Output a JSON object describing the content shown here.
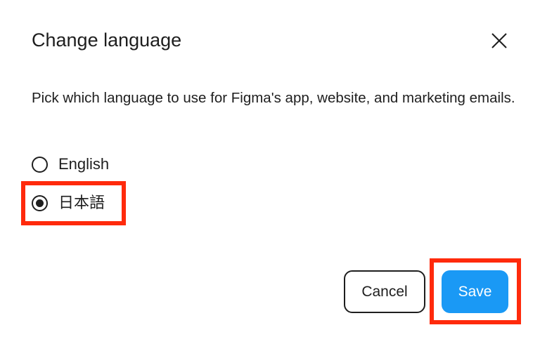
{
  "dialog": {
    "title": "Change language",
    "description": "Pick which language to use for Figma's app, website, and marketing emails.",
    "close_icon": "close-icon"
  },
  "languages": {
    "options": [
      {
        "label": "English",
        "selected": false
      },
      {
        "label": "日本語",
        "selected": true
      }
    ]
  },
  "actions": {
    "cancel_label": "Cancel",
    "save_label": "Save"
  },
  "colors": {
    "primary": "#1a99f5",
    "highlight": "#ff2a0c",
    "text": "#1e1e1e"
  }
}
